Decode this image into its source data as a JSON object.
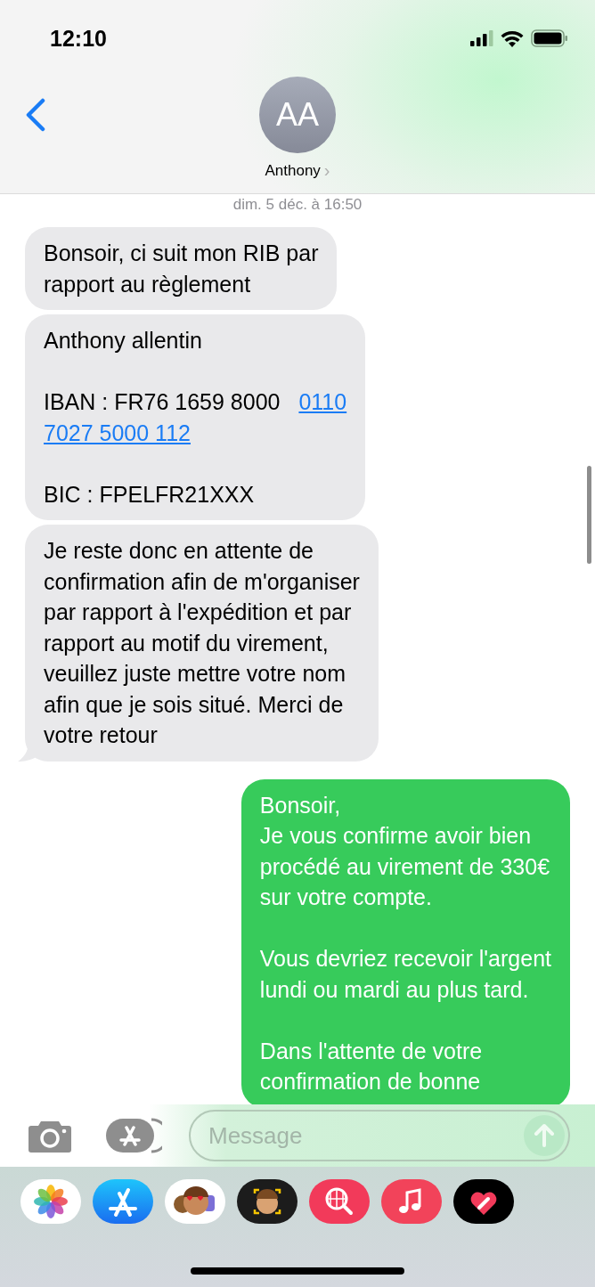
{
  "status_bar": {
    "time": "12:10"
  },
  "header": {
    "avatar_initials": "AA",
    "contact_name": "Anthony",
    "chevron": "›"
  },
  "timestamp": "dim. 5 déc. à 16:50",
  "messages": [
    {
      "kind": "incoming",
      "tail": false,
      "paragraphs": [
        [
          {
            "text": "Bonsoir, ci suit mon RIB par"
          },
          {
            "text": "rapport au règlement"
          }
        ]
      ]
    },
    {
      "kind": "incoming",
      "tail": false,
      "paragraphs": [
        [
          {
            "text": "Anthony allentin"
          }
        ],
        [
          {
            "text": "IBAN : FR76 1659 8000",
            "link": "0110"
          },
          {
            "link": "7027 5000 112"
          }
        ],
        [
          {
            "text": "BIC : FPELFR21XXX"
          }
        ]
      ]
    },
    {
      "kind": "incoming",
      "tail": true,
      "paragraphs": [
        [
          {
            "text": "Je reste donc en attente de"
          },
          {
            "text": "confirmation afin de m'organiser"
          },
          {
            "text": "par rapport à l'expédition et par"
          },
          {
            "text": "rapport au motif du virement,"
          },
          {
            "text": "veuillez juste mettre votre nom"
          },
          {
            "text": "afin que je sois situé. Merci de"
          },
          {
            "text": "votre retour"
          }
        ]
      ]
    },
    {
      "kind": "outgoing",
      "tail": false,
      "paragraphs": [
        [
          {
            "text": "Bonsoir,"
          },
          {
            "text": "Je vous confirme avoir bien"
          },
          {
            "text": "procédé au virement de 330€"
          },
          {
            "text": "sur votre compte."
          }
        ],
        [
          {
            "text": "Vous devriez recevoir l'argent"
          },
          {
            "text": "lundi ou mardi au plus tard."
          }
        ],
        [
          {
            "text": "Dans l'attente de votre"
          },
          {
            "text": "confirmation de bonne"
          }
        ]
      ]
    }
  ],
  "composer": {
    "placeholder": "Message"
  },
  "app_drawer": [
    {
      "kind": "photos"
    },
    {
      "kind": "appstore"
    },
    {
      "kind": "stickers"
    },
    {
      "kind": "memoji"
    },
    {
      "kind": "search"
    },
    {
      "kind": "music"
    },
    {
      "kind": "heart"
    }
  ]
}
